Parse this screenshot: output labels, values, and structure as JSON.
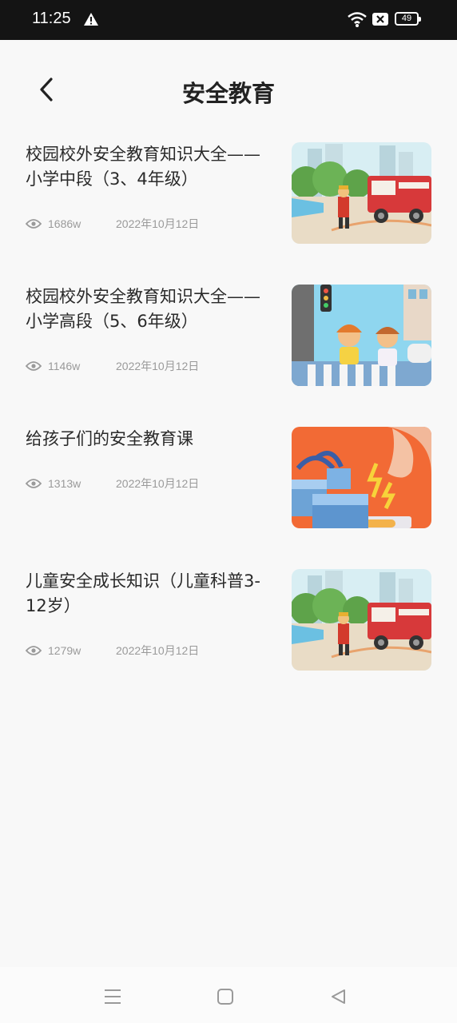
{
  "status_bar": {
    "time": "11:25",
    "battery": "49",
    "icons": [
      "warning-icon",
      "wifi-icon",
      "sim-x-icon",
      "battery-icon"
    ]
  },
  "header": {
    "title": "安全教育",
    "back_icon": "chevron-left-icon"
  },
  "articles": [
    {
      "title": "校园校外安全教育知识大全——小学中段（3、4年级）",
      "views": "1686w",
      "date": "2022年10月12日",
      "thumb": "firefighter-truck-illustration"
    },
    {
      "title": "校园校外安全教育知识大全——小学高段（5、6年级）",
      "views": "1146w",
      "date": "2022年10月12日",
      "thumb": "children-crosswalk-illustration"
    },
    {
      "title": "给孩子们的安全教育课",
      "views": "1313w",
      "date": "2022年10月12日",
      "thumb": "electric-outlet-illustration"
    },
    {
      "title": "儿童安全成长知识（儿童科普3-12岁）",
      "views": "1279w",
      "date": "2022年10月12日",
      "thumb": "firefighter-truck-illustration"
    }
  ],
  "nav_bar": {
    "icons": [
      "menu-icon",
      "home-square-icon",
      "back-triangle-icon"
    ]
  },
  "colors": {
    "status_bar_bg": "#141414",
    "page_bg": "#f8f8f8",
    "title_text": "#222222",
    "meta_text": "#9a9a9a",
    "thumb_orange": "#f26a35",
    "thumb_sky": "#a9dcec"
  }
}
